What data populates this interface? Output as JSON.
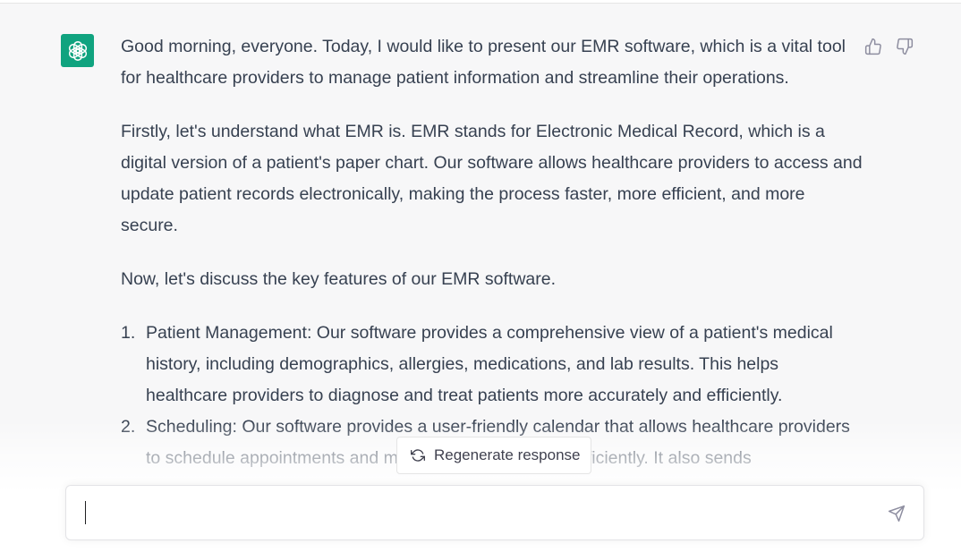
{
  "conversation": {
    "assistant": {
      "avatar_icon": "openai-logo-icon",
      "avatar_color": "#10a37f",
      "paragraphs": [
        "Good morning, everyone. Today, I would like to present our EMR software, which is a vital tool for healthcare providers to manage patient information and streamline their operations.",
        "Firstly, let's understand what EMR is. EMR stands for Electronic Medical Record, which is a digital version of a patient's paper chart. Our software allows healthcare providers to access and update patient records electronically, making the process faster, more efficient, and more secure.",
        "Now, let's discuss the key features of our EMR software."
      ],
      "list": [
        {
          "num": "1.",
          "text": "Patient Management: Our software provides a comprehensive view of a patient's medical history, including demographics, allergies, medications, and lab results. This helps healthcare providers to diagnose and treat patients more accurately and efficiently."
        },
        {
          "num": "2.",
          "text": "Scheduling: Our software provides a user-friendly calendar that allows healthcare providers to schedule appointments and manage their time more efficiently. It also sends"
        }
      ]
    },
    "feedback": {
      "thumb_up_icon": "thumbs-up-icon",
      "thumb_down_icon": "thumbs-down-icon"
    }
  },
  "regenerate": {
    "label": "Regenerate response",
    "icon": "refresh-icon"
  },
  "composer": {
    "value": "",
    "placeholder": "",
    "send_icon": "send-icon"
  }
}
